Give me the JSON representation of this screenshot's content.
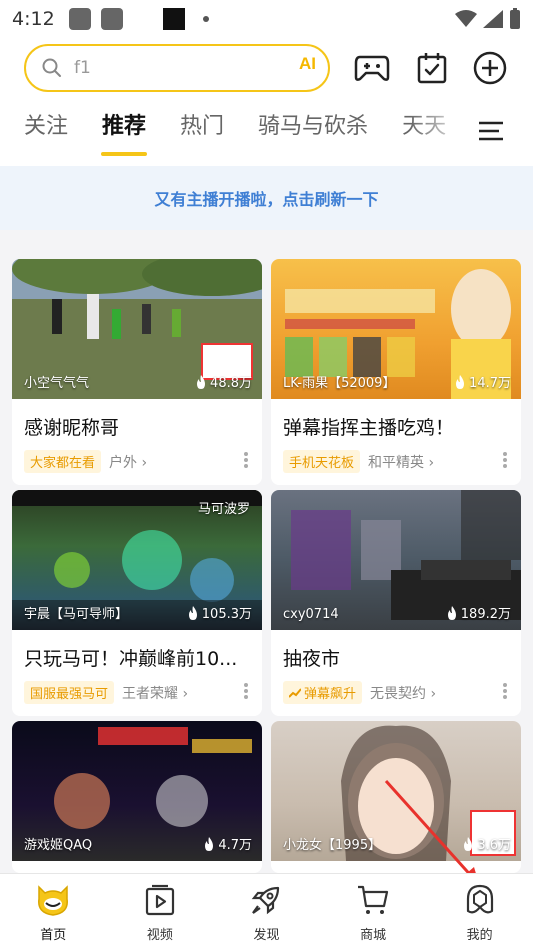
{
  "status_bar": {
    "time": "4:12"
  },
  "search": {
    "placeholder": "f1",
    "ai_label": "AI"
  },
  "top_icons": [
    "gamepad-icon",
    "calendar-check-icon",
    "add-icon"
  ],
  "tabs": [
    {
      "label": "关注",
      "active": false
    },
    {
      "label": "推荐",
      "active": true
    },
    {
      "label": "热门",
      "active": false
    },
    {
      "label": "骑马与砍杀",
      "active": false
    },
    {
      "label": "天天",
      "active": false
    }
  ],
  "refresh_banner": "又有主播开播啦，点击刷新一下",
  "cards": [
    {
      "streamer": "小空气气气",
      "viewers": "48.8万",
      "title": "感谢昵称哥",
      "tag": "大家都在看",
      "category": "户外",
      "overlay_name": ""
    },
    {
      "streamer": "LK-雨果【52009】",
      "viewers": "14.7万",
      "title": "弹幕指挥主播吃鸡！",
      "tag": "手机天花板",
      "category": "和平精英",
      "overlay_name": ""
    },
    {
      "streamer": "宇晨【马可导师】",
      "viewers": "105.3万",
      "title": "只玩马可！冲巅峰前10...",
      "tag": "国服最强马可",
      "category": "王者荣耀",
      "overlay_name": "马可波罗"
    },
    {
      "streamer": "cxy0714",
      "viewers": "189.2万",
      "title": "抽夜市",
      "tag": "弹幕飙升",
      "category": "无畏契约",
      "overlay_name": ""
    },
    {
      "streamer": "游戏姬QAQ",
      "viewers": "4.7万",
      "title": "",
      "tag": "",
      "category": "",
      "overlay_name": ""
    },
    {
      "streamer": "小龙女【1995】",
      "viewers": "3.6万",
      "title": "",
      "tag": "",
      "category": "",
      "overlay_name": ""
    }
  ],
  "bottom_nav": [
    {
      "label": "首页",
      "icon": "home-mascot-icon",
      "active": true
    },
    {
      "label": "视频",
      "icon": "video-icon",
      "active": false
    },
    {
      "label": "发现",
      "icon": "rocket-icon",
      "active": false
    },
    {
      "label": "商城",
      "icon": "cart-icon",
      "active": false
    },
    {
      "label": "我的",
      "icon": "profile-icon",
      "active": false
    }
  ],
  "colors": {
    "accent": "#f5c518",
    "tag_text": "#e89b00",
    "banner_text": "#3f7fd4",
    "annotation": "#e8322c"
  }
}
